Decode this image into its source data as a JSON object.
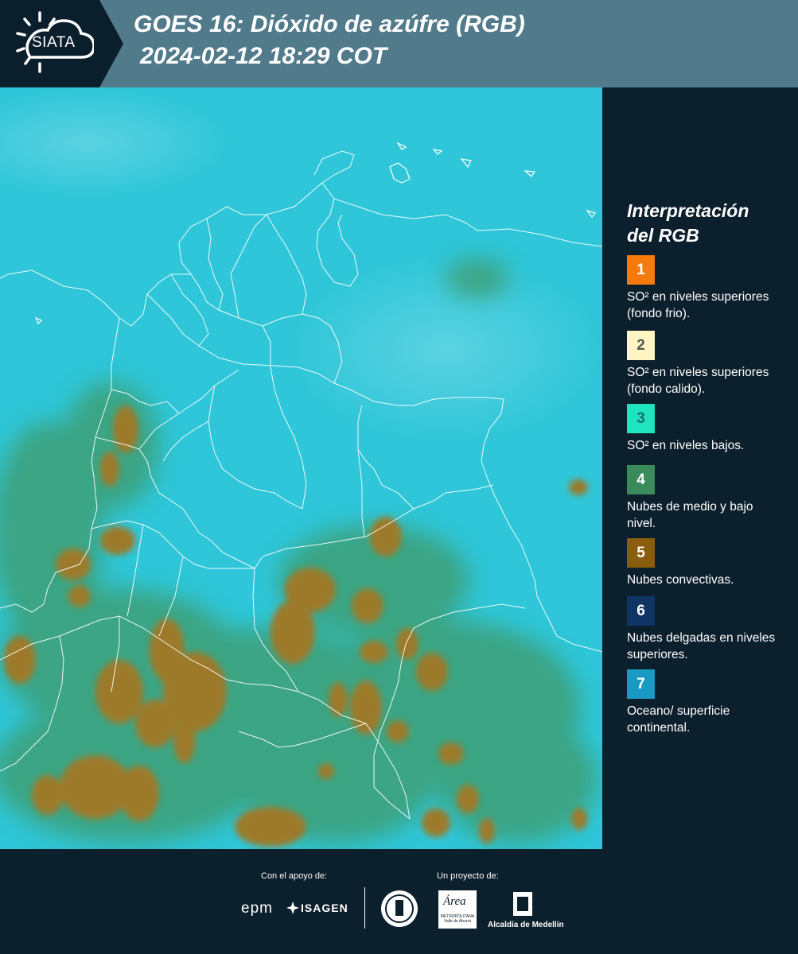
{
  "header": {
    "logo_text": "SIATA",
    "title_line1": "GOES 16: Dióxido de azúfre (RGB)",
    "title_line2": "2024-02-12 18:29 COT"
  },
  "legend": {
    "title_line1": "Interpretación",
    "title_line2": "del RGB",
    "items": [
      {
        "number": "1",
        "label": "SO² en niveles superiores (fondo frio).",
        "color": "#f47b0b",
        "text_color": "#ffffff"
      },
      {
        "number": "2",
        "label": "SO² en niveles superiores (fondo calido).",
        "color": "#fdf6c2",
        "text_color": "#555555"
      },
      {
        "number": "3",
        "label": "SO² en niveles bajos.",
        "color": "#1ee4c0",
        "text_color": "#1f6f70"
      },
      {
        "number": "4",
        "label": "Nubes de medio y bajo nivel.",
        "color": "#3a8a5c",
        "text_color": "#ffffff"
      },
      {
        "number": "5",
        "label": "Nubes convectivas.",
        "color": "#8a5c0e",
        "text_color": "#ffffff"
      },
      {
        "number": "6",
        "label": "Nubes delgadas en niveles superiores.",
        "color": "#0f3565",
        "text_color": "#ffffff"
      },
      {
        "number": "7",
        "label": "Oceano/ superficie continental.",
        "color": "#1a9ac2",
        "text_color": "#ffffff"
      }
    ]
  },
  "footer": {
    "support_caption": "Con el apoyo de:",
    "project_caption": "Un proyecto de:",
    "epm": "epm",
    "isagen": "ISAGEN",
    "metropolitana_logo": "Área",
    "metropolitana_sub": "METROPOLITANA Valle de Aburrá",
    "alcaldia": "Alcaldía de Medellín"
  },
  "map": {
    "background_color": "#2ec6d8",
    "convective_color": "#9c7a2a",
    "low_cloud_color": "#3f9a68",
    "border_color": "#ffffff"
  }
}
